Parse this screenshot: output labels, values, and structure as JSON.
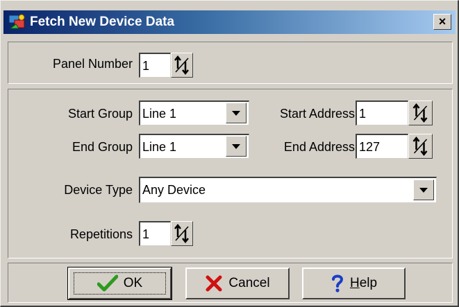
{
  "dialog": {
    "title": "Fetch New Device Data",
    "close_label": "×"
  },
  "panel": {
    "label": "Panel Number",
    "value": "1"
  },
  "start_group": {
    "label": "Start Group",
    "value": "Line 1"
  },
  "end_group": {
    "label": "End Group",
    "value": "Line 1"
  },
  "start_address": {
    "label": "Start Address",
    "value": "1"
  },
  "end_address": {
    "label": "End Address",
    "value": "127"
  },
  "device_type": {
    "label": "Device Type",
    "value": "Any Device"
  },
  "repetitions": {
    "label": "Repetitions",
    "value": "1"
  },
  "buttons": {
    "ok": "OK",
    "cancel": "Cancel",
    "help_prefix": "",
    "help_underlined": "H",
    "help_rest": "elp"
  },
  "icons": {
    "ok": "check-icon",
    "cancel": "x-icon",
    "help": "question-icon",
    "spin": "spinner-arrows-icon",
    "dropdown": "chevron-down-icon"
  },
  "colors": {
    "title_start": "#0a246a",
    "title_end": "#a6caf0",
    "face": "#d4d0c8",
    "ok_check": "#2e9a1e",
    "cancel_x": "#d01010",
    "help_q": "#1a3ec8"
  }
}
